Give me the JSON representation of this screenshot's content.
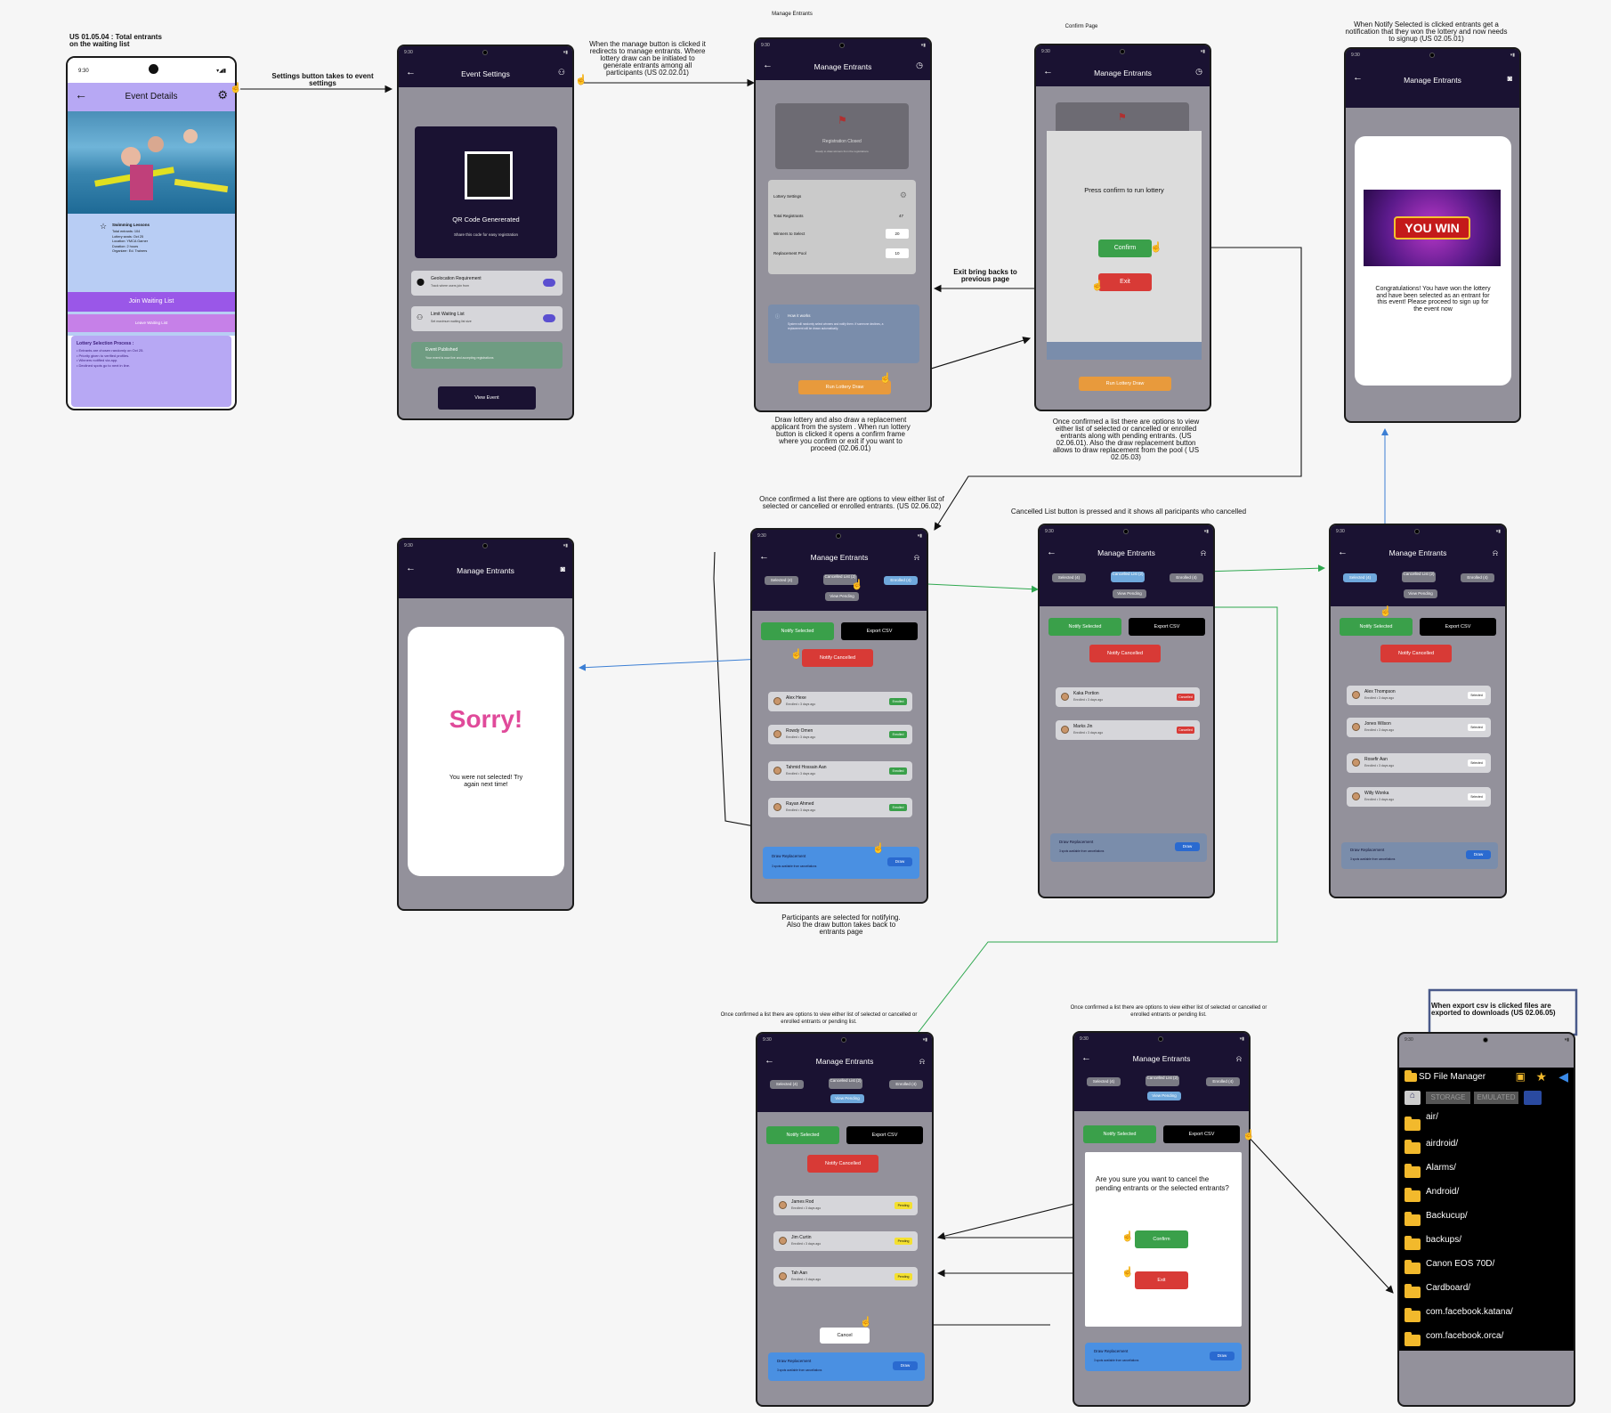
{
  "annotations": {
    "waitlist": "US 01.05.04 : Total entrants on the waiting list",
    "settings_arrow": "Settings button takes to event settings",
    "manage_redirect": "When the manage button is clicked it redirects to manage entrants. Where lottery draw can be initiated to generate entrants among all participants (US 02.02.01)",
    "manage_title": "Manage Entrants",
    "confirm_title": "Confirm Page",
    "notify_title": "When Notify Selected is clicked entrants get a notification that they won the lottery and now needs to signup (US 02.05.01)",
    "draw_lottery": "Draw lottery and also draw a replacement applicant from the system . When run lottery button is clicked it opens a confirm frame where you confirm or exit if you want to proceed (02.06.01)",
    "exit_back": "Exit bring backs to previous page",
    "confirmed_options": "Once confirmed a list there are options to view either list of selected or cancelled or enrolled entrants along with pending entrants. (US 02.06.01). Also the draw replacement button allows to draw replacement from the pool ( US 02.05.03)",
    "confirmed_list": "Once confirmed a list there are options to view either list of selected or cancelled or enrolled entrants. (US 02.06.02)",
    "cancelled_list": "Cancelled List button is pressed and it shows all paricipants who cancelled",
    "participants": "Participants are selected for notifying. Also the draw button takes back to entrants page",
    "pending_a": "Once confirmed a list there are options to view either list of selected or cancelled or enrolled entrants or pending list.",
    "pending_b": "Once confirmed a list there are options to view either list of selected or cancelled or enrolled entrants or pending list.",
    "export": "When export csv is clicked files are exported to downloads (US 02.06.05)"
  },
  "event_details": {
    "time": "9:30",
    "title": "Event Details",
    "info_title": "Swimming Lessons",
    "info_lines": [
      "Total entrants: 104",
      "Lottery seats: Oct 25",
      "Location: YMCA Garner",
      "Duration: 2 hours",
      "Organizer: Ed. Trainers"
    ],
    "join": "Join Waiting List",
    "leave": "Leave Waiting List",
    "process_title": "Lottery Selection Process :",
    "process_lines": [
      "• Entrants are chosen randomly on Oct 25.",
      "• Priority given to verified profiles.",
      "• Winners notified via app.",
      "• Declined spots go to next in line."
    ]
  },
  "event_settings": {
    "title": "Event Settings",
    "qr_title": "QR Code Genererated",
    "qr_sub": "Share this code for easy registration",
    "geo_title": "Geolocation Requirement",
    "geo_sub": "Track where users join from",
    "limit_title": "Limit Waiting List",
    "limit_sub": "Set maximum waiting list size",
    "pub_title": "Event Published",
    "pub_sub": "Your event is now live and accepting registrations",
    "view_btn": "View Event"
  },
  "manage": {
    "title": "Manage Entrants",
    "reg_closed": "Registration Closed",
    "reg_sub": "Ready to draw winners from the registrations",
    "lottery_settings": "Lottery Settings",
    "total_reg": "Total Registrants",
    "total_val": "47",
    "winners": "Winners to Select",
    "winners_val": "20",
    "pool": "Replacement Pool",
    "pool_val": "10",
    "how_title": "How it works",
    "how_text": "System will randomly select winners and notify them. If someone declines, a replacement will be drawn automatically.",
    "run_btn": "Run Lottery Draw"
  },
  "confirm": {
    "title": "Manage Entrants",
    "prompt": "Press confirm to run lottery",
    "confirm_btn": "Confirm",
    "exit_btn": "Exit",
    "run_btn": "Run Lottery Draw"
  },
  "win": {
    "title": "Manage Entrants",
    "banner": "YOU WIN",
    "message": "Congratulations! You have won the lottery and have been selected as an entrant for this event! Please proceed to sign up for the event now"
  },
  "sorry": {
    "title": "Manage Entrants",
    "heading": "Sorry!",
    "message": "You were not selected! Try again next time!"
  },
  "lists": {
    "tabs": [
      "Selected (4)",
      "Cancelled List (2)",
      "Enrolled (4)"
    ],
    "view_pending": "View Pending",
    "notify_selected": "Notify Selected",
    "export_csv": "Export CSV",
    "notify_cancelled": "Notify Cancelled",
    "draw_title": "Draw Replacement",
    "draw_sub": "3 spots available from cancellations",
    "draw_btn": "Draw",
    "enrolled": [
      {
        "name": "Alex Hexe",
        "sub": "Enrolled • 3 days ago",
        "badge": "Enrolled"
      },
      {
        "name": "Rowdy Omen",
        "sub": "Enrolled • 3 days ago",
        "badge": "Enrolled"
      },
      {
        "name": "Tahmid Hossain Aan",
        "sub": "Enrolled • 3 days ago",
        "badge": "Enrolled"
      },
      {
        "name": "Rayan Ahmed",
        "sub": "Enrolled • 3 days ago",
        "badge": "Enrolled"
      }
    ],
    "cancelled": [
      {
        "name": "Kaka Portion",
        "sub": "Enrolled • 3 days ago",
        "badge": "Cancelled"
      },
      {
        "name": "Marks Jin",
        "sub": "Enrolled • 3 days ago",
        "badge": "Cancelled"
      }
    ],
    "selected": [
      {
        "name": "Alex Thompson",
        "sub": "Enrolled • 3 days ago",
        "badge": "Selected"
      },
      {
        "name": "Jones Wilson",
        "sub": "Enrolled • 3 days ago",
        "badge": "Selected"
      },
      {
        "name": "Rosefir Aan",
        "sub": "Enrolled • 3 days ago",
        "badge": "Selected"
      },
      {
        "name": "Willy Wonka",
        "sub": "Enrolled • 3 days ago",
        "badge": "Selected"
      }
    ],
    "pending": [
      {
        "name": "James Rod",
        "sub": "Enrolled • 3 days ago",
        "badge": "Pending"
      },
      {
        "name": "Jim Curtin",
        "sub": "Enrolled • 3 days ago",
        "badge": "Pending"
      },
      {
        "name": "Tah Aan",
        "sub": "Enrolled • 3 days ago",
        "badge": "Pending"
      }
    ],
    "cancel_btn": "Cancel",
    "dialog_text": "Are you sure you want to cancel the pending entrants or the selected entrants?",
    "dialog_confirm": "Confirm",
    "dialog_exit": "Exit"
  },
  "files": {
    "title": "SD File Manager",
    "tabs": [
      "STORAGE",
      "EMULATED"
    ],
    "folders": [
      "air/",
      "airdroid/",
      "Alarms/",
      "Android/",
      "Backucup/",
      "backups/",
      "Canon EOS 70D/",
      "Cardboard/",
      "com.facebook.katana/",
      "com.facebook.orca/"
    ]
  }
}
